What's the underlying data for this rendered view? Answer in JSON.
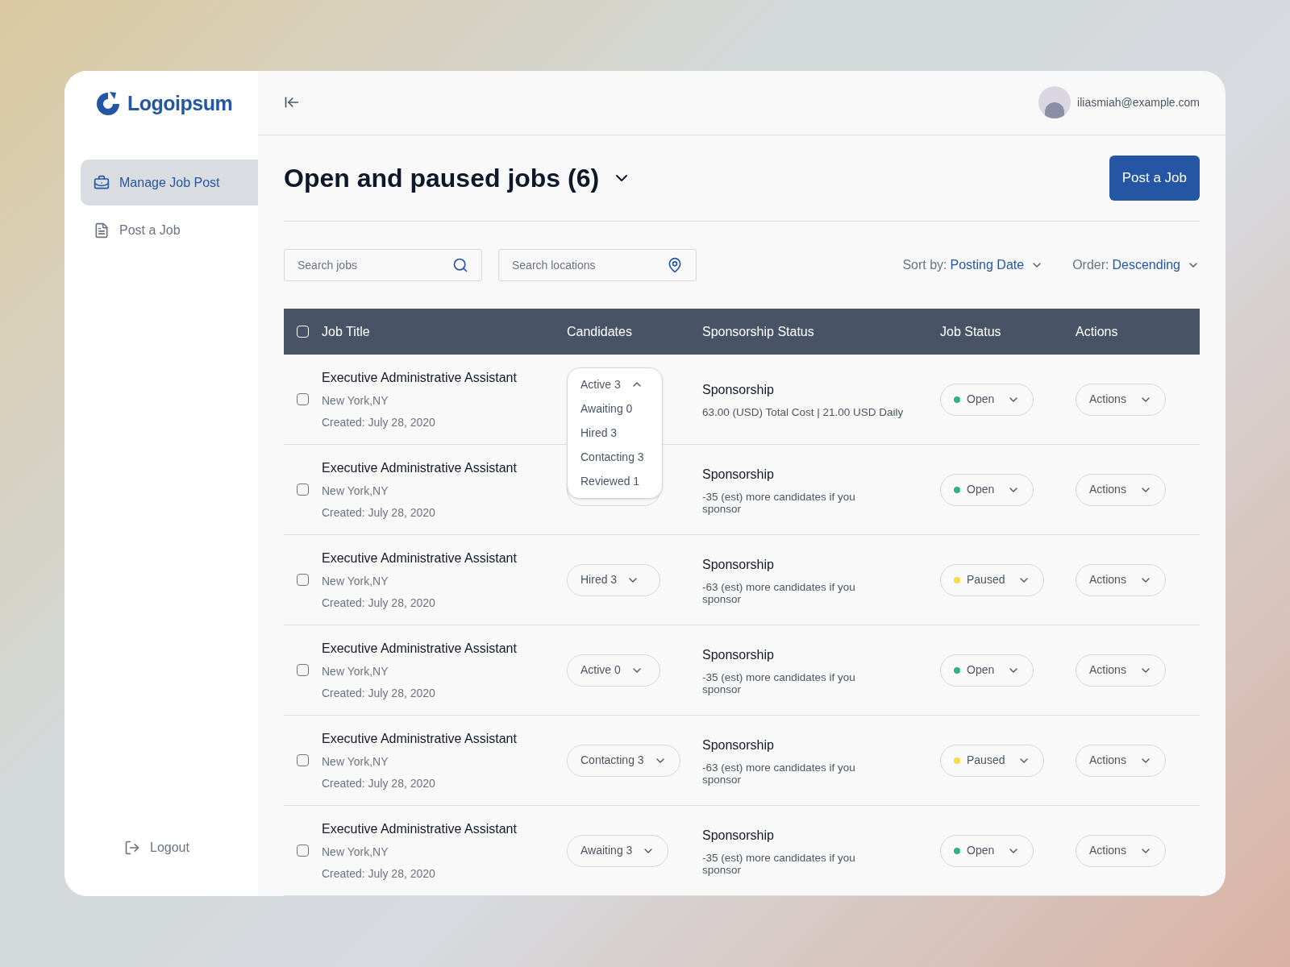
{
  "sidebar": {
    "logo": "Logoipsum",
    "items": [
      {
        "label": "Manage Job Post",
        "selected": true
      },
      {
        "label": "Post a Job",
        "selected": false
      }
    ],
    "logout": "Logout"
  },
  "topbar": {
    "email": "iliasmiah@example.com"
  },
  "header": {
    "title": "Open and paused jobs (6)",
    "button": "Post a Job"
  },
  "filters": {
    "search_jobs": {
      "placeholder": "Search jobs"
    },
    "search_locations": {
      "placeholder": "Search locations"
    },
    "sort": {
      "label": "Sort by:",
      "value": "Posting Date"
    },
    "order": {
      "label": "Order:",
      "value": "Descending"
    }
  },
  "table": {
    "select_all": {
      "checked": false
    },
    "columns": [
      "Job Title",
      "Candidates",
      "Sponsorship Status",
      "Job Status",
      "Actions"
    ],
    "rows": [
      {
        "checked": false,
        "title": "Executive Administrative Assistant",
        "location": "New York,NY",
        "created": "Created: July 28, 2020",
        "candidates": {
          "label": "Active 3",
          "expanded": true,
          "options": [
            "Awaiting 0",
            "Hired 3",
            "Contacting 3",
            "Reviewed 1"
          ]
        },
        "sponsorship": "Sponsorship",
        "sponsorship_detail": "63.00 (USD) Total Cost | 21.00 USD Daily",
        "status": {
          "label": "Open",
          "color": "#2fb380"
        },
        "action": "Actions"
      },
      {
        "checked": false,
        "title": "Executive Administrative Assistant",
        "location": "New York,NY",
        "created": "Created: July 28, 2020",
        "candidates": {
          "expanded": false
        },
        "sponsorship": "Sponsorship",
        "sponsorship_detail": "-35 (est) more candidates if you sponsor",
        "status": {
          "label": "Open",
          "color": "#2fb380"
        },
        "action": "Actions"
      },
      {
        "checked": false,
        "title": "Executive Administrative Assistant",
        "location": "New York,NY",
        "created": "Created: July 28, 2020",
        "candidates": {
          "label": "Hired 3",
          "expanded": false
        },
        "sponsorship": "Sponsorship",
        "sponsorship_detail": "-63 (est) more candidates if you sponsor",
        "status": {
          "label": "Paused",
          "color": "#f5d94e"
        },
        "action": "Actions"
      },
      {
        "checked": false,
        "title": "Executive Administrative Assistant",
        "location": "New York,NY",
        "created": "Created: July 28, 2020",
        "candidates": {
          "label": "Active 0",
          "expanded": false
        },
        "sponsorship": "Sponsorship",
        "sponsorship_detail": "-35 (est) more candidates if you sponsor",
        "status": {
          "label": "Open",
          "color": "#2fb380"
        },
        "action": "Actions"
      },
      {
        "checked": false,
        "title": "Executive Administrative Assistant",
        "location": "New York,NY",
        "created": "Created: July 28, 2020",
        "candidates": {
          "label": "Contacting 3",
          "expanded": false
        },
        "sponsorship": "Sponsorship",
        "sponsorship_detail": "-63 (est) more candidates if you sponsor",
        "status": {
          "label": "Paused",
          "color": "#f5d94e"
        },
        "action": "Actions"
      },
      {
        "checked": false,
        "title": "Executive Administrative Assistant",
        "location": "New York,NY",
        "created": "Created: July 28, 2020",
        "candidates": {
          "label": "Awaiting 3",
          "expanded": false
        },
        "sponsorship": "Sponsorship",
        "sponsorship_detail": "-35 (est) more candidates if you sponsor",
        "status": {
          "label": "Open",
          "color": "#2fb380"
        },
        "action": "Actions"
      }
    ]
  }
}
